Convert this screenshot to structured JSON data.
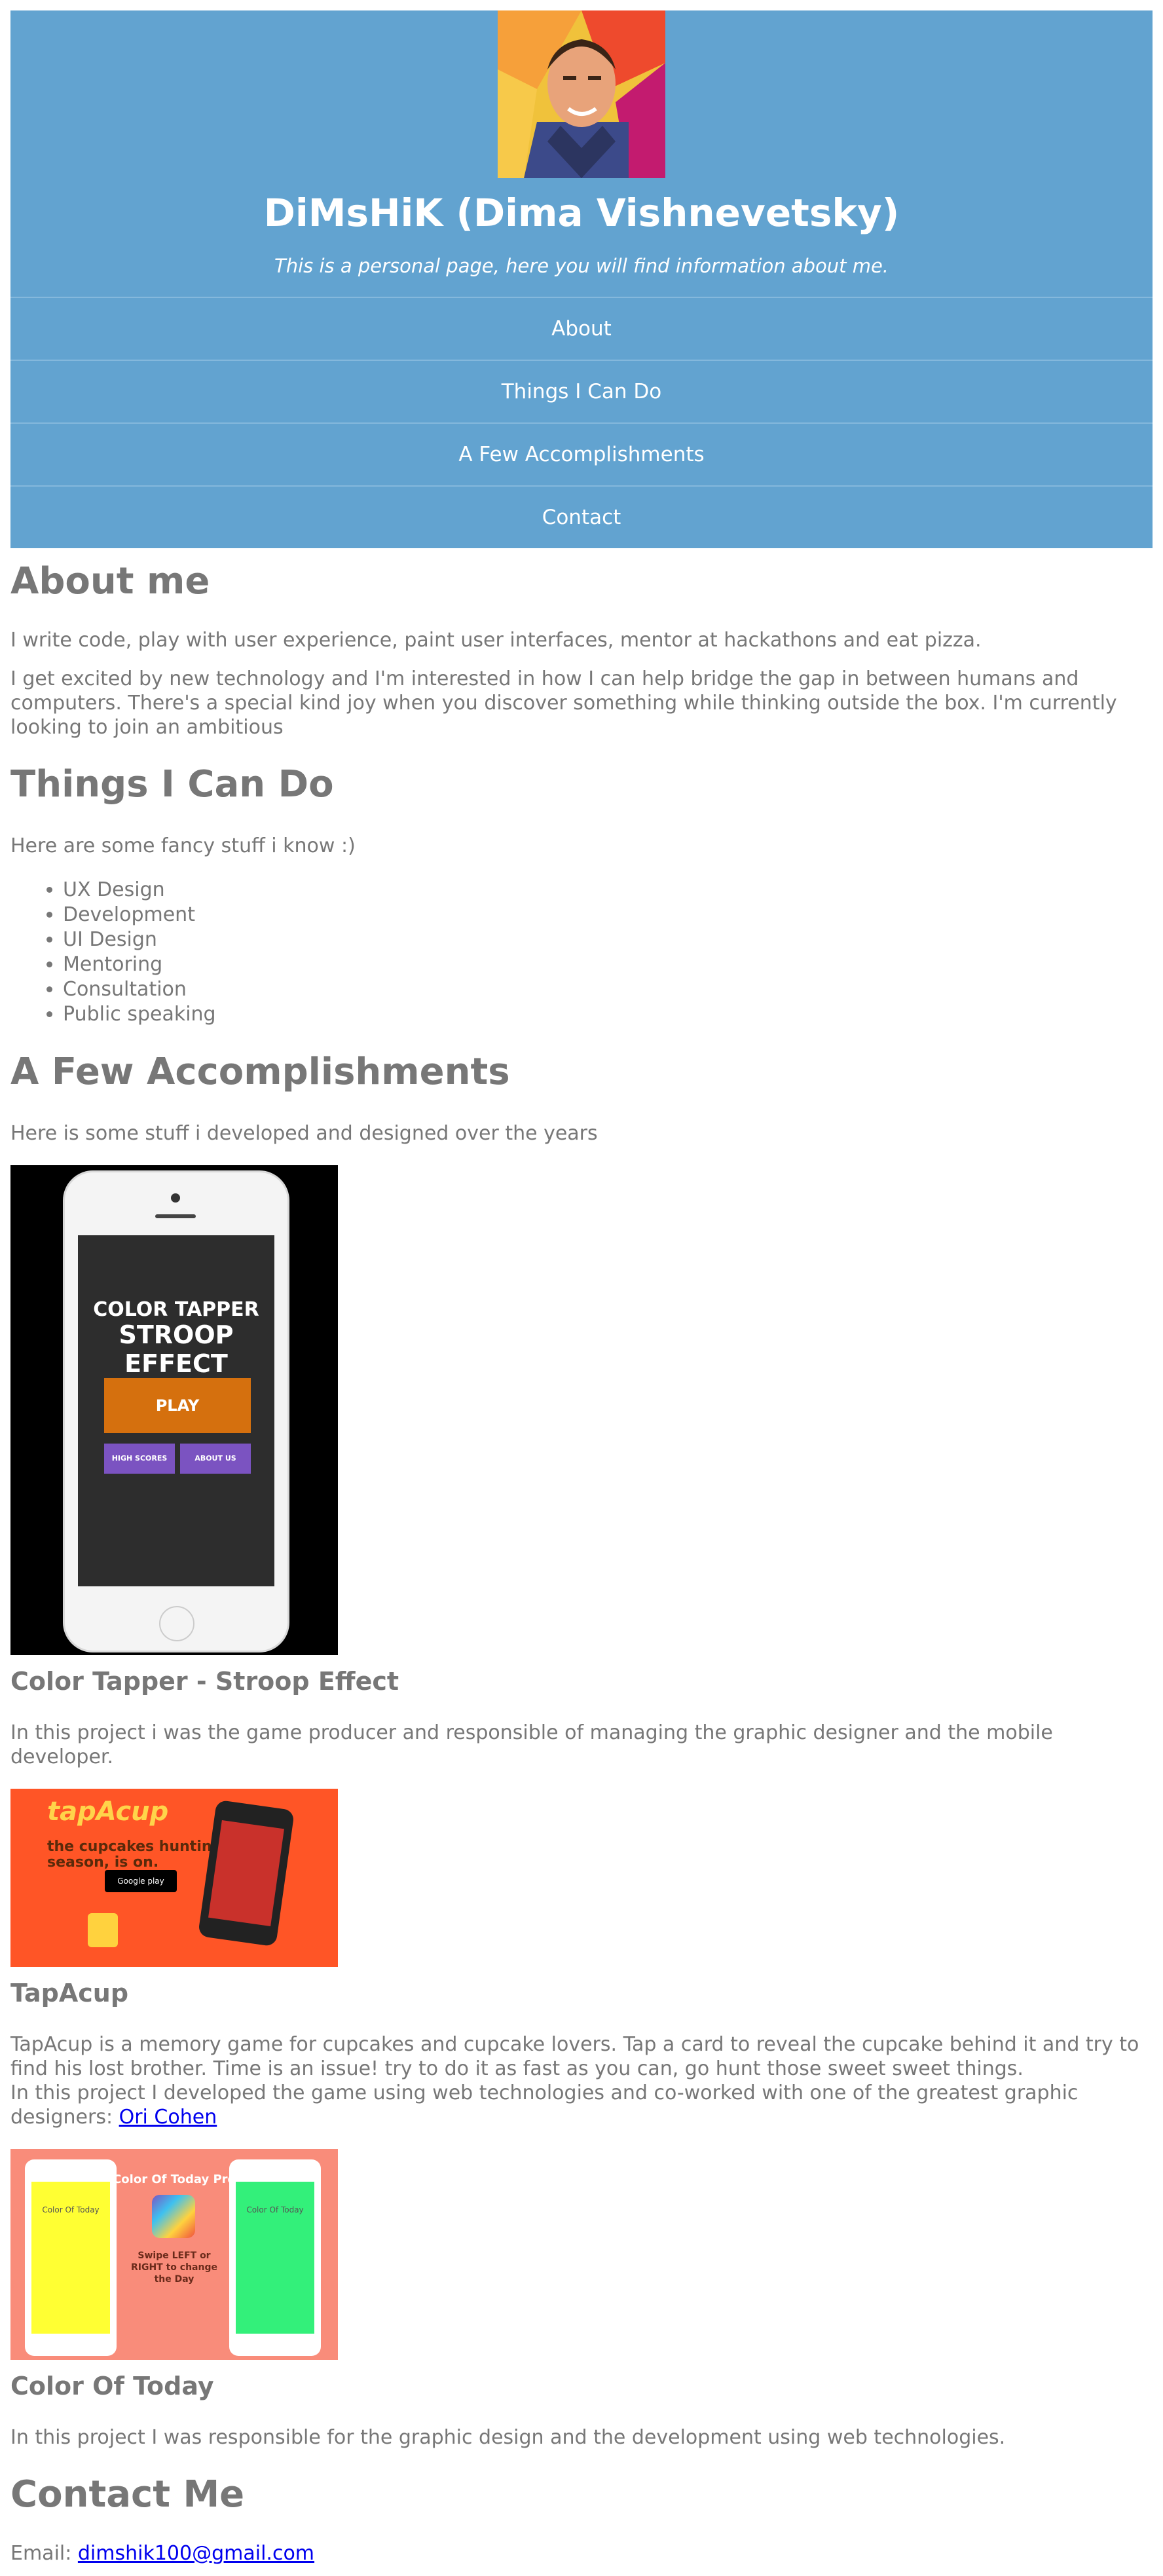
{
  "header": {
    "title": "DiMsHiK (Dima Vishnevetsky)",
    "tagline": "This is a personal page, here you will find information about me.",
    "nav": [
      {
        "label": "About"
      },
      {
        "label": "Things I Can Do"
      },
      {
        "label": "A Few Accomplishments"
      },
      {
        "label": "Contact"
      }
    ]
  },
  "about": {
    "title": "About me",
    "p1": "I write code, play with user experience, paint user interfaces, mentor at hackathons and eat pizza.",
    "p2": "I get excited by new technology and I'm interested in how I can help bridge the gap in between humans and computers. There's a special kind joy when you discover something while thinking outside the box. I'm currently looking to join an ambitious"
  },
  "things": {
    "title": "Things I Can Do",
    "intro": "Here are some fancy stuff i know :)",
    "items": [
      "UX Design",
      "Development",
      "UI Design",
      "Mentoring",
      "Consultation",
      "Public speaking"
    ]
  },
  "accomplishments": {
    "title": "A Few Accomplishments",
    "intro": "Here is some stuff i developed and designed over the years",
    "projects": [
      {
        "title": "Color Tapper - Stroop Effect",
        "description": "In this project i was the game producer and responsible of managing the graphic designer and the mobile developer.",
        "image_text": {
          "line1": "COLOR TAPPER",
          "line2": "STROOP EFFECT",
          "play": "PLAY",
          "high_scores": "HIGH SCORES",
          "about_us": "ABOUT US"
        }
      },
      {
        "title": "TapAcup",
        "description": "TapAcup is a memory game for cupcakes and cupcake lovers. Tap a card to reveal the cupcake behind it and try to find his lost brother. Time is an issue! try to do it as fast as you can, go hunt those sweet sweet things.",
        "credit_prefix": "In this project I developed the game using web technologies and co-worked with one of the greatest graphic designers:",
        "credit_link": "Ori Cohen",
        "image_text": {
          "logo": "tapAcup",
          "line1": "the cupcakes hunting",
          "line2": "season, is on.",
          "store": "Google play"
        }
      },
      {
        "title": "Color Of Today",
        "description": "In this project I was responsible for the graphic design and the development using web technologies.",
        "image_text": {
          "title": "Color Of Today Pro",
          "swipe": "Swipe LEFT or RIGHT to change the Day",
          "phone_label": "Color Of Today"
        }
      }
    ]
  },
  "contact": {
    "title": "Contact Me",
    "email_label": "Email:",
    "email": "dimshik100@gmail.com"
  },
  "colors": {
    "header_bg": "#62a3d0",
    "text": "#777777",
    "link": "#0000ee"
  }
}
